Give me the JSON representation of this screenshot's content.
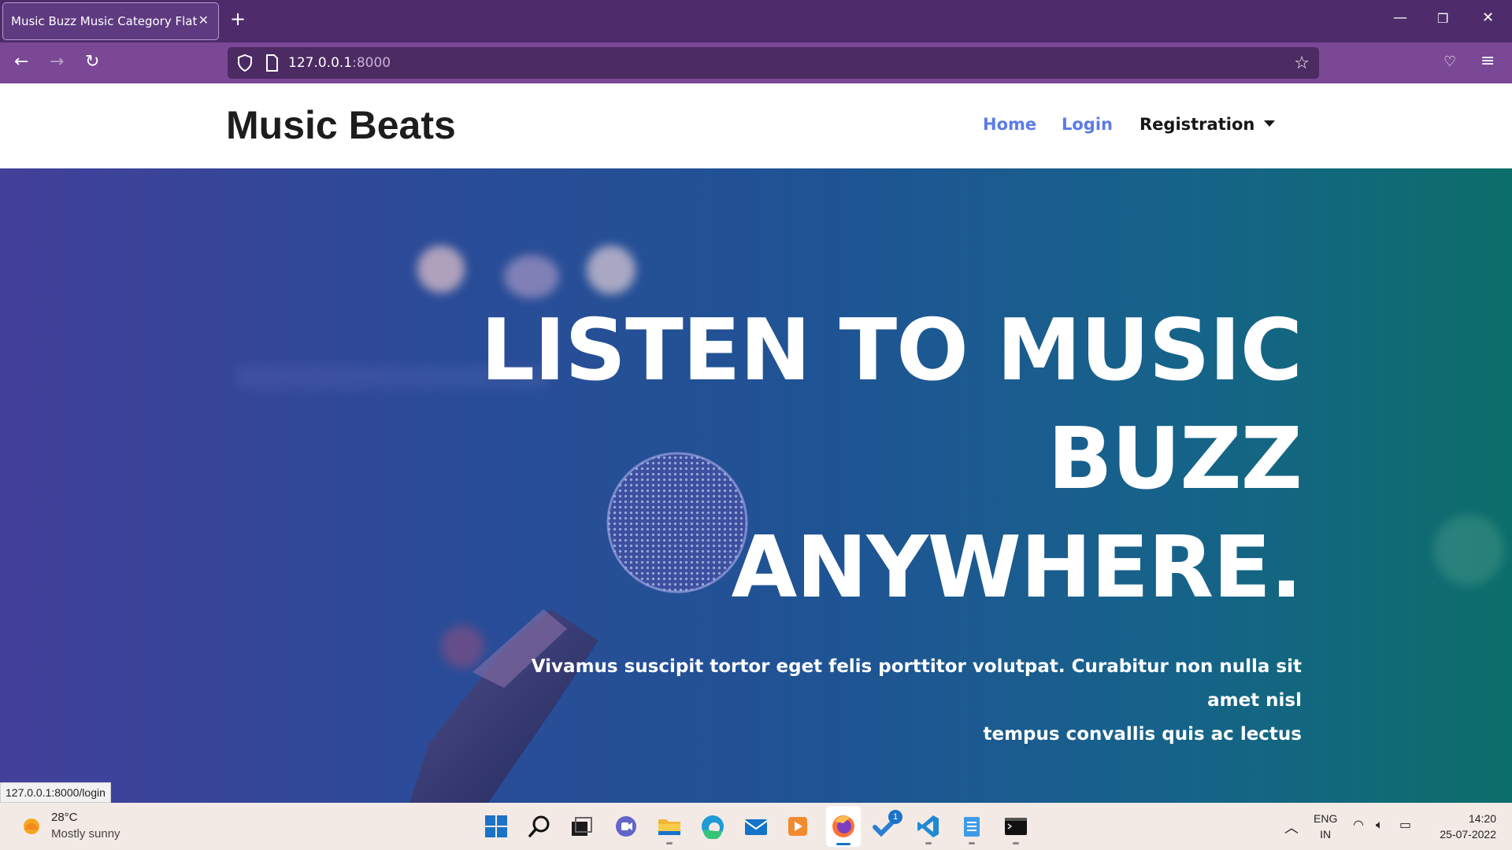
{
  "browser": {
    "tab_title": "Music Buzz Music Category Flat Boo",
    "tab_close": "✕",
    "new_tab": "+",
    "url_host": "127.0.0.1",
    "url_port": ":8000",
    "status_link": "127.0.0.1:8000/login",
    "accent_color": "#7a4895"
  },
  "site": {
    "brand": "Music Beats",
    "nav": {
      "home": "Home",
      "login": "Login",
      "registration": "Registration"
    },
    "link_color": "#5b7be9"
  },
  "hero": {
    "title_lines": [
      "LISTEN TO MUSIC",
      "BUZZ",
      "ANYWHERE."
    ],
    "subtitle_lines": [
      "Vivamus suscipit tortor eget felis porttitor volutpat. Curabitur non nulla sit amet nisl",
      "tempus convallis quis ac lectus"
    ]
  },
  "taskbar": {
    "weather_temp": "28°C",
    "weather_desc": "Mostly sunny",
    "apps": [
      "start-icon",
      "search-icon",
      "task-view-icon",
      "chat-icon",
      "file-explorer-icon",
      "edge-icon",
      "mail-icon",
      "media-player-icon",
      "firefox-icon",
      "todo-icon",
      "vscode-icon",
      "notepad-icon",
      "terminal-icon"
    ],
    "todo_badge": "1",
    "lang_line1": "ENG",
    "lang_line2": "IN",
    "time": "14:20",
    "date": "25-07-2022"
  }
}
